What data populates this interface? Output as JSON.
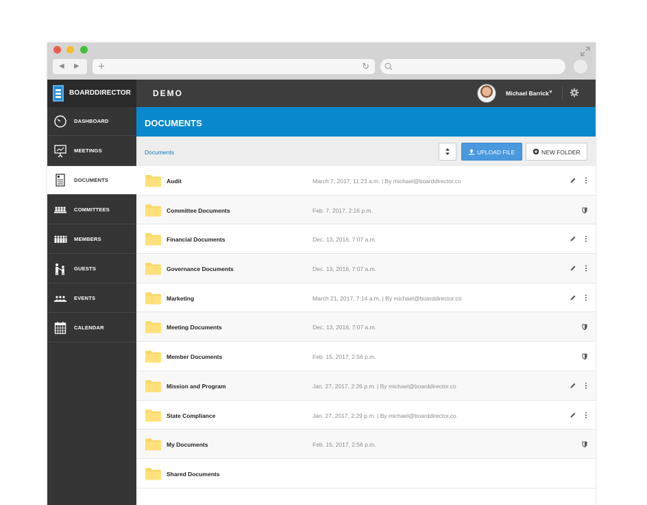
{
  "app": {
    "brand": "BOARDDIRECTOR",
    "org": "DEMO",
    "user_name": "Michael Barrick",
    "accent": "#0a88ce"
  },
  "sidebar": {
    "items": [
      {
        "label": "DASHBOARD",
        "icon": "dashboard-gauge-icon",
        "active": false
      },
      {
        "label": "MEETINGS",
        "icon": "presentation-board-icon",
        "active": false
      },
      {
        "label": "DOCUMENTS",
        "icon": "document-icon",
        "active": true
      },
      {
        "label": "COMMITTEES",
        "icon": "group-table-icon",
        "active": false
      },
      {
        "label": "MEMBERS",
        "icon": "members-group-icon",
        "active": false
      },
      {
        "label": "GUESTS",
        "icon": "guests-icon",
        "active": false
      },
      {
        "label": "EVENTS",
        "icon": "events-people-icon",
        "active": false
      },
      {
        "label": "CALENDAR",
        "icon": "calendar-icon",
        "active": false
      }
    ]
  },
  "header": {
    "title": "DOCUMENTS"
  },
  "toolbar": {
    "breadcrumb": "Documents",
    "upload_label": "UPLOAD FILE",
    "new_folder_label": "NEW FOLDER"
  },
  "folders": [
    {
      "name": "Audit",
      "meta": "March 7, 2017, 11:23 a.m. | By michael@boarddirector.co",
      "action": "edit"
    },
    {
      "name": "Committee Documents",
      "meta": "Feb. 7, 2017, 2:16 p.m.",
      "action": "shield"
    },
    {
      "name": "Financial Documents",
      "meta": "Dec. 13, 2016, 7:07 a.m.",
      "action": "edit"
    },
    {
      "name": "Governance Documents",
      "meta": "Dec. 13, 2016, 7:07 a.m.",
      "action": "edit"
    },
    {
      "name": "Marketing",
      "meta": "March 21, 2017, 7:14 a.m. | By michael@boarddirector.co",
      "action": "edit"
    },
    {
      "name": "Meeting Documents",
      "meta": "Dec. 13, 2016, 7:07 a.m.",
      "action": "shield"
    },
    {
      "name": "Member Documents",
      "meta": "Feb. 15, 2017, 2:56 p.m.",
      "action": "shield"
    },
    {
      "name": "Mission and Program",
      "meta": "Jan. 27, 2017, 2:26 p.m. | By michael@boarddirector.co",
      "action": "edit"
    },
    {
      "name": "State Compliance",
      "meta": "Jan. 27, 2017, 2:29 p.m. | By michael@boarddirector.co",
      "action": "edit"
    },
    {
      "name": "My Documents",
      "meta": "Feb. 15, 2017, 2:56 p.m.",
      "action": "shield"
    },
    {
      "name": "Shared Documents",
      "meta": "",
      "action": "none"
    }
  ]
}
